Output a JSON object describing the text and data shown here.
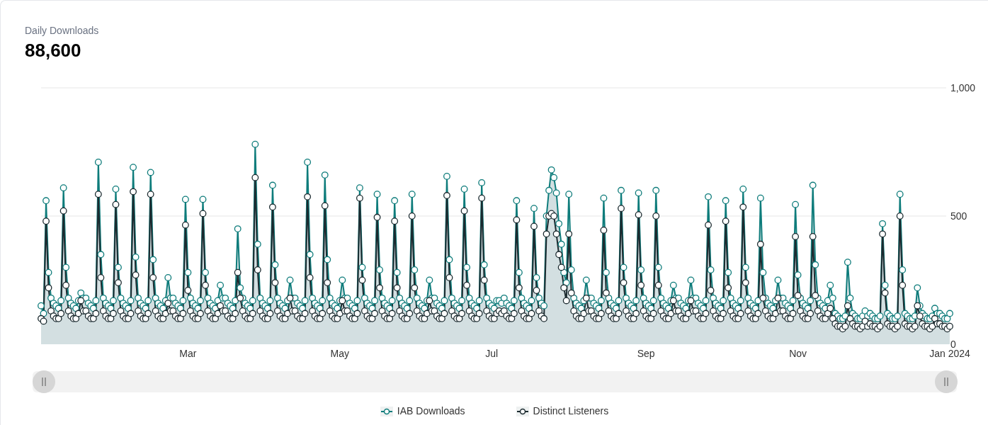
{
  "header": {
    "title": "Daily Downloads",
    "value": "88,600"
  },
  "chart_data": {
    "type": "line",
    "ylim": [
      0,
      1000
    ],
    "categories": [
      null,
      null,
      null,
      null,
      null,
      null,
      null,
      null,
      null,
      null,
      null,
      null,
      null,
      null,
      null,
      null,
      null,
      null,
      null,
      null,
      null,
      null,
      null,
      null,
      null,
      null,
      null,
      null,
      null,
      null,
      null,
      null,
      null,
      null,
      null,
      null,
      null,
      null,
      null,
      null,
      null,
      null,
      null,
      null,
      null,
      null,
      null,
      null,
      null,
      null,
      null,
      null,
      null,
      null,
      null,
      null,
      null,
      null,
      null,
      "Mar",
      null,
      null,
      null,
      null,
      null,
      null,
      null,
      null,
      null,
      null,
      null,
      null,
      null,
      null,
      null,
      null,
      null,
      null,
      null,
      null,
      null,
      null,
      null,
      null,
      null,
      null,
      null,
      null,
      null,
      null,
      null,
      null,
      null,
      null,
      null,
      null,
      null,
      null,
      null,
      null,
      null,
      null,
      null,
      null,
      null,
      null,
      null,
      null,
      null,
      null,
      null,
      null,
      null,
      null,
      null,
      null,
      null,
      null,
      null,
      null,
      "May",
      null,
      null,
      null,
      null,
      null,
      null,
      null,
      null,
      null,
      null,
      null,
      null,
      null,
      null,
      null,
      null,
      null,
      null,
      null,
      null,
      null,
      null,
      null,
      null,
      null,
      null,
      null,
      null,
      null,
      null,
      null,
      null,
      null,
      null,
      null,
      null,
      null,
      null,
      null,
      null,
      null,
      null,
      null,
      null,
      null,
      null,
      null,
      null,
      null,
      null,
      null,
      null,
      null,
      null,
      null,
      null,
      null,
      null,
      null,
      null,
      "Jul",
      null,
      null,
      null,
      null,
      null,
      null,
      null,
      null,
      null,
      null,
      null,
      null,
      null,
      null,
      null,
      null,
      null,
      null,
      null,
      null,
      null,
      null,
      null,
      null,
      null,
      null,
      null,
      null,
      null,
      null,
      null,
      null,
      null,
      null,
      null,
      null,
      null,
      null,
      null,
      null,
      null,
      null,
      null,
      null,
      null,
      null,
      null,
      null,
      null,
      null,
      null,
      null,
      null,
      null,
      null,
      null,
      null,
      null,
      null,
      null,
      null,
      "Sep",
      null,
      null,
      null,
      null,
      null,
      null,
      null,
      null,
      null,
      null,
      null,
      null,
      null,
      null,
      null,
      null,
      null,
      null,
      null,
      null,
      null,
      null,
      null,
      null,
      null,
      null,
      null,
      null,
      null,
      null,
      null,
      null,
      null,
      null,
      null,
      null,
      null,
      null,
      null,
      null,
      null,
      null,
      null,
      null,
      null,
      null,
      null,
      null,
      null,
      null,
      null,
      null,
      null,
      null,
      null,
      null,
      null,
      null,
      null,
      null,
      "Nov",
      null,
      null,
      null,
      null,
      null,
      null,
      null,
      null,
      null,
      null,
      null,
      null,
      null,
      null,
      null,
      null,
      null,
      null,
      null,
      null,
      null,
      null,
      null,
      null,
      null,
      null,
      null,
      null,
      null,
      null,
      null,
      null,
      null,
      null,
      null,
      null,
      null,
      null,
      null,
      null,
      null,
      null,
      null,
      null,
      null,
      null,
      null,
      null,
      null,
      null,
      null,
      null,
      null,
      null,
      null,
      null,
      null,
      null,
      null,
      null,
      "Jan 2024"
    ],
    "yticks": [
      {
        "value": 0,
        "label": "0"
      },
      {
        "value": 500,
        "label": "500"
      },
      {
        "value": 1000,
        "label": "1,000"
      }
    ],
    "series": [
      {
        "name": "IAB Downloads",
        "color": "#0e7c7b",
        "type": "area",
        "marker": "circle",
        "values": [
          150,
          120,
          560,
          280,
          180,
          160,
          150,
          140,
          170,
          610,
          300,
          180,
          160,
          150,
          140,
          170,
          200,
          180,
          180,
          160,
          150,
          140,
          170,
          710,
          350,
          180,
          160,
          150,
          140,
          170,
          605,
          300,
          180,
          160,
          150,
          140,
          170,
          690,
          340,
          180,
          160,
          150,
          140,
          170,
          670,
          330,
          180,
          160,
          150,
          140,
          170,
          260,
          180,
          180,
          160,
          150,
          140,
          170,
          565,
          280,
          180,
          160,
          150,
          140,
          170,
          565,
          280,
          180,
          160,
          150,
          140,
          170,
          230,
          180,
          180,
          160,
          150,
          140,
          170,
          450,
          220,
          180,
          160,
          150,
          140,
          170,
          780,
          390,
          180,
          160,
          150,
          140,
          170,
          620,
          310,
          180,
          160,
          150,
          140,
          170,
          250,
          180,
          180,
          160,
          150,
          140,
          170,
          710,
          350,
          180,
          160,
          150,
          140,
          170,
          660,
          330,
          180,
          160,
          150,
          140,
          170,
          250,
          180,
          180,
          160,
          150,
          140,
          170,
          610,
          300,
          180,
          160,
          150,
          140,
          170,
          585,
          290,
          180,
          160,
          150,
          140,
          170,
          560,
          280,
          180,
          160,
          150,
          140,
          170,
          585,
          290,
          180,
          160,
          150,
          140,
          170,
          250,
          180,
          180,
          160,
          150,
          140,
          170,
          655,
          330,
          180,
          160,
          150,
          140,
          170,
          605,
          300,
          180,
          160,
          150,
          140,
          170,
          630,
          310,
          180,
          160,
          150,
          140,
          170,
          170,
          160,
          180,
          160,
          150,
          140,
          170,
          560,
          280,
          180,
          160,
          150,
          140,
          170,
          530,
          260,
          180,
          160,
          150,
          500,
          600,
          680,
          650,
          590,
          470,
          390,
          280,
          240,
          585,
          290,
          180,
          160,
          150,
          140,
          170,
          250,
          180,
          180,
          160,
          150,
          140,
          170,
          570,
          280,
          180,
          160,
          150,
          140,
          170,
          600,
          300,
          180,
          160,
          150,
          140,
          170,
          590,
          290,
          180,
          160,
          150,
          140,
          170,
          600,
          300,
          180,
          160,
          150,
          140,
          170,
          230,
          180,
          180,
          160,
          150,
          140,
          170,
          250,
          180,
          180,
          160,
          150,
          140,
          170,
          575,
          290,
          180,
          160,
          150,
          140,
          170,
          560,
          280,
          180,
          160,
          150,
          140,
          170,
          605,
          300,
          180,
          160,
          150,
          140,
          170,
          570,
          280,
          180,
          160,
          150,
          140,
          170,
          250,
          180,
          180,
          160,
          150,
          140,
          170,
          545,
          270,
          180,
          160,
          150,
          140,
          170,
          620,
          310,
          180,
          160,
          150,
          140,
          170,
          230,
          180,
          120,
          110,
          100,
          100,
          110,
          320,
          180,
          120,
          110,
          100,
          100,
          110,
          130,
          110,
          120,
          110,
          100,
          100,
          110,
          470,
          230,
          120,
          110,
          100,
          100,
          110,
          585,
          290,
          120,
          110,
          100,
          100,
          110,
          220,
          150,
          120,
          110,
          100,
          100,
          110,
          140,
          120,
          120,
          110,
          100,
          100,
          120
        ]
      },
      {
        "name": "Distinct Listeners",
        "color": "#1c2b30",
        "type": "line",
        "marker": "circle",
        "values": [
          100,
          90,
          480,
          220,
          130,
          110,
          100,
          100,
          120,
          520,
          230,
          130,
          110,
          100,
          100,
          120,
          170,
          130,
          130,
          110,
          100,
          100,
          120,
          585,
          260,
          130,
          110,
          100,
          100,
          120,
          545,
          240,
          130,
          110,
          100,
          100,
          120,
          595,
          270,
          130,
          110,
          100,
          100,
          120,
          585,
          260,
          130,
          110,
          100,
          100,
          120,
          160,
          130,
          130,
          110,
          100,
          100,
          120,
          465,
          210,
          130,
          110,
          100,
          100,
          120,
          510,
          230,
          130,
          110,
          100,
          100,
          120,
          150,
          130,
          130,
          110,
          100,
          100,
          120,
          280,
          180,
          130,
          110,
          100,
          100,
          120,
          650,
          290,
          130,
          110,
          100,
          100,
          120,
          535,
          240,
          130,
          110,
          100,
          100,
          120,
          180,
          130,
          130,
          110,
          100,
          100,
          120,
          575,
          260,
          130,
          110,
          100,
          100,
          120,
          540,
          240,
          130,
          110,
          100,
          100,
          120,
          170,
          130,
          130,
          110,
          100,
          100,
          120,
          570,
          250,
          130,
          110,
          100,
          100,
          120,
          495,
          220,
          130,
          110,
          100,
          100,
          120,
          480,
          220,
          130,
          110,
          100,
          100,
          120,
          500,
          220,
          130,
          110,
          100,
          100,
          120,
          170,
          130,
          130,
          110,
          100,
          100,
          120,
          580,
          260,
          130,
          110,
          100,
          100,
          120,
          520,
          230,
          130,
          110,
          100,
          100,
          120,
          570,
          250,
          130,
          110,
          100,
          100,
          120,
          130,
          120,
          130,
          110,
          100,
          100,
          120,
          485,
          220,
          130,
          110,
          100,
          100,
          120,
          460,
          210,
          130,
          110,
          100,
          430,
          500,
          510,
          500,
          430,
          350,
          300,
          220,
          170,
          430,
          200,
          130,
          110,
          100,
          100,
          120,
          180,
          130,
          130,
          110,
          100,
          100,
          120,
          445,
          200,
          130,
          110,
          100,
          100,
          120,
          530,
          240,
          130,
          110,
          100,
          100,
          120,
          505,
          230,
          130,
          110,
          100,
          100,
          120,
          500,
          230,
          130,
          110,
          100,
          100,
          120,
          170,
          130,
          130,
          110,
          100,
          100,
          120,
          170,
          130,
          130,
          110,
          100,
          100,
          120,
          465,
          210,
          130,
          110,
          100,
          100,
          120,
          480,
          220,
          130,
          110,
          100,
          100,
          120,
          535,
          240,
          130,
          110,
          100,
          100,
          120,
          390,
          180,
          130,
          110,
          100,
          100,
          120,
          180,
          130,
          130,
          110,
          100,
          100,
          120,
          420,
          190,
          130,
          110,
          100,
          100,
          120,
          420,
          190,
          130,
          110,
          100,
          100,
          120,
          140,
          100,
          80,
          70,
          70,
          60,
          70,
          150,
          100,
          80,
          70,
          70,
          60,
          70,
          90,
          70,
          80,
          70,
          70,
          60,
          70,
          430,
          200,
          80,
          70,
          70,
          60,
          70,
          500,
          230,
          80,
          70,
          70,
          60,
          70,
          150,
          110,
          80,
          70,
          70,
          60,
          70,
          100,
          80,
          80,
          70,
          70,
          60,
          70
        ]
      }
    ]
  }
}
